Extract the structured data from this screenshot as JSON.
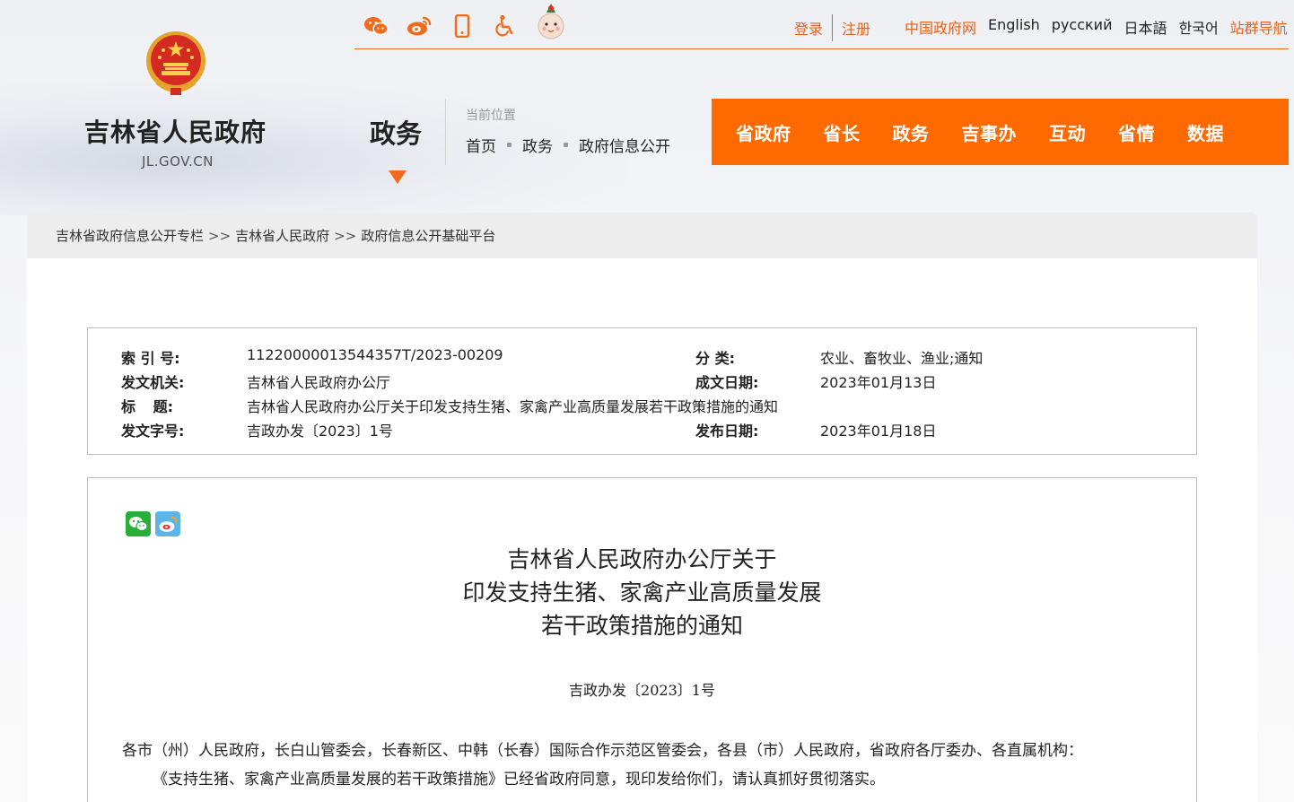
{
  "header": {
    "social_icons": [
      "wechat-icon",
      "weibo-icon",
      "mobile-icon",
      "accessibility-icon",
      "mascot-icon"
    ],
    "auth": {
      "login": "登录",
      "register": "注册"
    },
    "links": [
      {
        "label": "中国政府网",
        "highlight": true
      },
      {
        "label": "English",
        "highlight": false
      },
      {
        "label": "русский",
        "highlight": false
      },
      {
        "label": "日本語",
        "highlight": false
      },
      {
        "label": "한국어",
        "highlight": false
      },
      {
        "label": "站群导航",
        "highlight": true
      }
    ],
    "site_name": "吉林省人民政府",
    "site_domain": "JL.GOV.CN",
    "section_title": "政务",
    "location_label": "当前位置",
    "location_crumbs": [
      "首页",
      "政务",
      "政府信息公开"
    ],
    "nav": [
      "省政府",
      "省长",
      "政务",
      "吉事办",
      "互动",
      "省情",
      "数据"
    ],
    "accent_color": "#ff6a00"
  },
  "breadcrumb": {
    "items": [
      "吉林省政府信息公开专栏",
      "吉林省人民政府",
      "政府信息公开基础平台"
    ],
    "separator": ">>"
  },
  "meta": {
    "index_label": "索 引 号:",
    "index_value": "11220000013544357T/2023-00209",
    "category_label": "分 类:",
    "category_value": "农业、畜牧业、渔业;通知",
    "issuer_label": "发文机关:",
    "issuer_value": "吉林省人民政府办公厅",
    "date_made_label": "成文日期:",
    "date_made_value": "2023年01月13日",
    "title_label": "标 题:",
    "title_value": "吉林省人民政府办公厅关于印发支持生猪、家禽产业高质量发展若干政策措施的通知",
    "docno_label": "发文字号:",
    "docno_value": "吉政办发〔2023〕1号",
    "published_label": "发布日期:",
    "published_value": "2023年01月18日"
  },
  "article": {
    "title_lines": [
      "吉林省人民政府办公厅关于",
      "印发支持生猪、家禽产业高质量发展",
      "若干政策措施的通知"
    ],
    "doc_number": "吉政办发〔2023〕1号",
    "addressee": "各市（州）人民政府，长白山管委会，长春新区、中韩（长春）国际合作示范区管委会，各县（市）人民政府，省政府各厅委办、各直属机构：",
    "body": "《支持生猪、家禽产业高质量发展的若干政策措施》已经省政府同意，现印发给你们，请认真抓好贯彻落实。"
  }
}
